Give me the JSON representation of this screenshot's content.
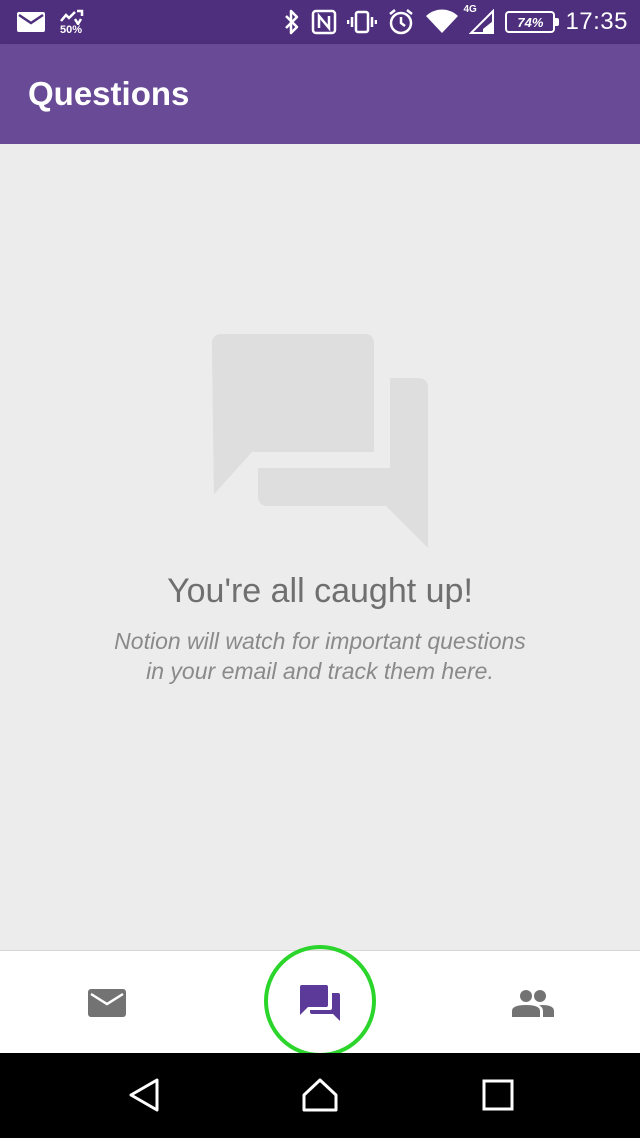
{
  "status_bar": {
    "signal_percent": "50%",
    "network_type": "4G",
    "battery": "74%",
    "time": "17:35",
    "icons": [
      "mail-icon",
      "data-saver-icon",
      "bluetooth-icon",
      "nfc-icon",
      "vibrate-icon",
      "alarm-icon",
      "wifi-icon",
      "cell-signal-icon",
      "battery-icon"
    ]
  },
  "app_bar": {
    "title": "Questions"
  },
  "empty_state": {
    "icon": "chat-bubbles-icon",
    "title": "You're all caught up!",
    "subtitle_line1": "Notion will watch for important questions",
    "subtitle_line2": "in your email and track them here."
  },
  "bottom_nav": {
    "items": [
      {
        "icon": "mail-icon",
        "active": false
      },
      {
        "icon": "chat-icon",
        "active": true
      },
      {
        "icon": "people-icon",
        "active": false
      }
    ]
  },
  "system_nav": {
    "buttons": [
      "back-icon",
      "home-icon",
      "recent-apps-icon"
    ]
  },
  "colors": {
    "status_bar": "#4e2f7d",
    "app_bar": "#694a96",
    "accent": "#5b3a9a",
    "highlight": "#2bd52b",
    "background": "#ececec"
  }
}
